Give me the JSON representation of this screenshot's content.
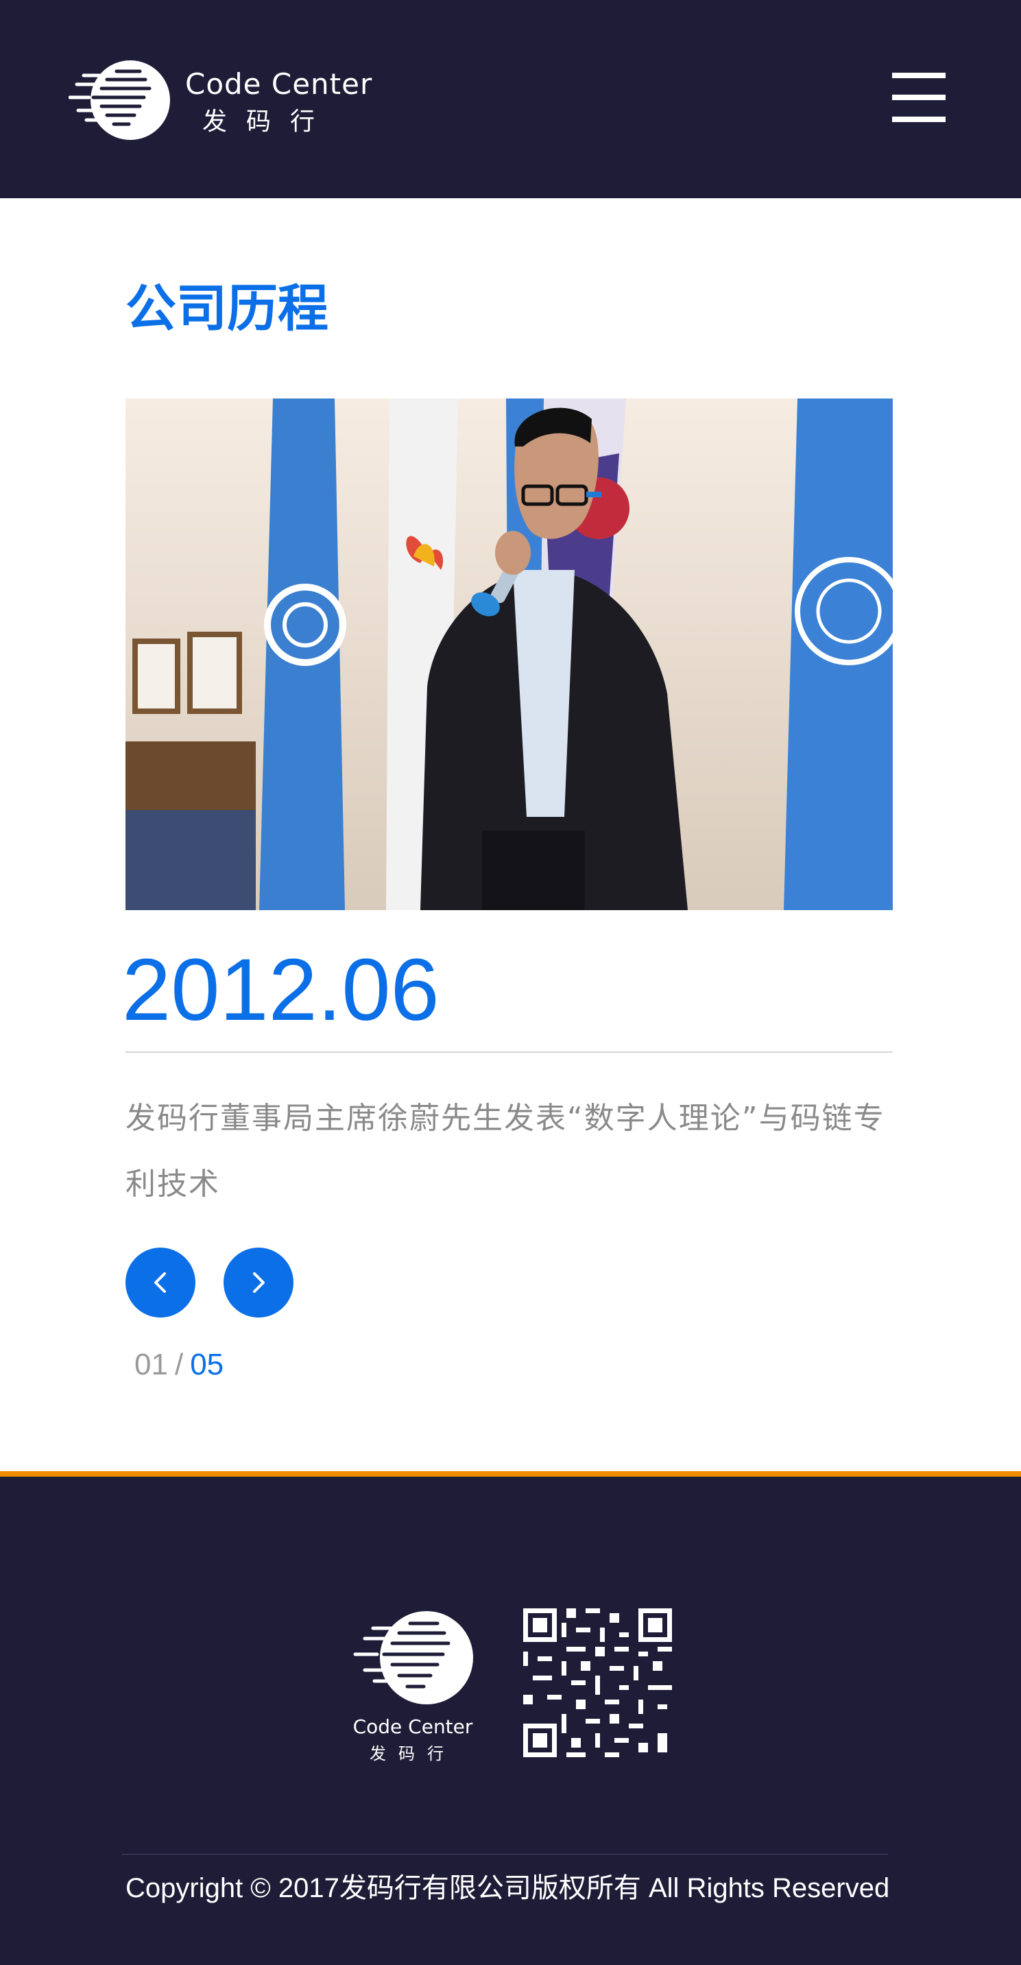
{
  "header": {
    "logo": {
      "name_en": "Code Center",
      "name_cn": "发码行"
    },
    "menu_icon": "hamburger-menu-icon"
  },
  "main": {
    "section_title": "公司历程",
    "milestone": {
      "date": "2012.06",
      "description": "发码行董事局主席徐蔚先生发表“数字人理论”与码链专利技术"
    },
    "pager": {
      "current": "01",
      "separator": "/",
      "total": "05"
    },
    "nav": {
      "prev_icon": "chevron-left-icon",
      "next_icon": "chevron-right-icon"
    }
  },
  "footer": {
    "logo": {
      "name_en": "Code Center",
      "name_cn": "发码行"
    },
    "qr_icon": "qr-code-icon",
    "copyright": "Copyright  ©  2017发码行有限公司版权所有 All Rights Reserved"
  },
  "colors": {
    "header_bg": "#1f1c37",
    "accent_blue": "#0b6fe8",
    "footer_accent": "#f08c00",
    "muted_text": "#8a8a8a"
  }
}
